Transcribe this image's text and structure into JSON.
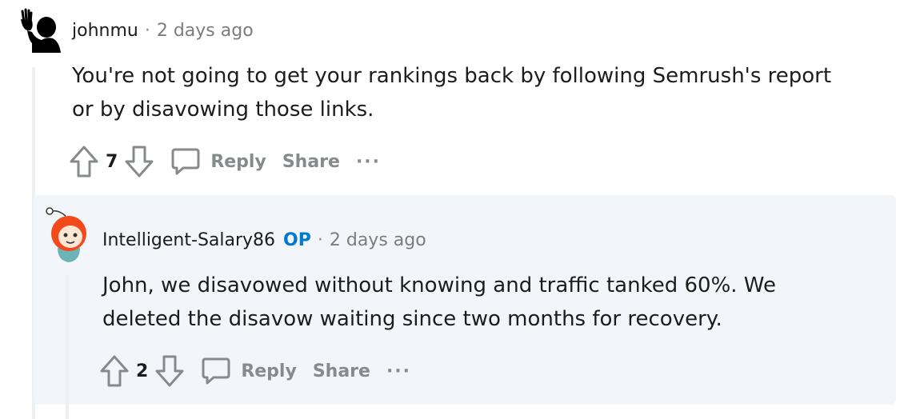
{
  "comments": [
    {
      "username": "johnmu",
      "separator": "·",
      "time": "2 days ago",
      "body": [
        "You're not going to get your rankings back by following Semrush's report",
        "or by disavowing those links."
      ],
      "score": "7",
      "reply_label": "Reply",
      "share_label": "Share",
      "more_label": "···"
    },
    {
      "username": "Intelligent-Salary86",
      "badge": "OP",
      "separator": "·",
      "time": "2 days ago",
      "body": [
        "John, we disavowed without knowing and traffic tanked 60%. We",
        "deleted the disavow waiting since two months for recovery."
      ],
      "score": "2",
      "reply_label": "Reply",
      "share_label": "Share",
      "more_label": "···"
    }
  ],
  "colors": {
    "op_badge": "#0079d3",
    "reply_bg": "#f2f6fa",
    "muted": "#878a8c"
  },
  "icons": [
    "upvote-icon",
    "downvote-icon",
    "comment-bubble-icon",
    "more-icon",
    "avatar"
  ]
}
